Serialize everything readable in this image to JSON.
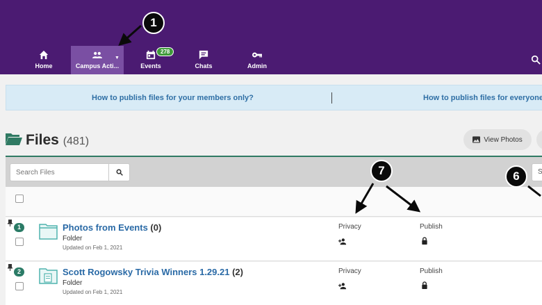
{
  "nav": {
    "items": [
      {
        "label": "Home",
        "icon": "home-icon"
      },
      {
        "label": "Campus Acti...",
        "icon": "people-icon",
        "active": true
      },
      {
        "label": "Events",
        "icon": "calendar-icon",
        "badge": "278"
      },
      {
        "label": "Chats",
        "icon": "chat-icon"
      },
      {
        "label": "Admin",
        "icon": "key-icon"
      }
    ]
  },
  "banner": {
    "link_left": "How to publish files for your members only?",
    "link_right": "How to publish files for everyone t"
  },
  "files": {
    "title": "Files",
    "count": "(481)",
    "view_photos_label": "View Photos"
  },
  "toolbar": {
    "search_placeholder": "Search Files",
    "sort_label": "S"
  },
  "rows": [
    {
      "badge": "1",
      "name": "Photos from Events",
      "count": "(0)",
      "type": "Folder",
      "updated": "Updated on Feb 1, 2021",
      "privacy_label": "Privacy",
      "publish_label": "Publish"
    },
    {
      "badge": "2",
      "name": "Scott Rogowsky Trivia Winners 1.29.21",
      "count": "(2)",
      "type": "Folder",
      "updated": "Updated on Feb 1, 2021",
      "privacy_label": "Privacy",
      "publish_label": "Publish"
    }
  ],
  "annotations": {
    "step_1": "1",
    "step_7": "7",
    "step_6": "6"
  },
  "colors": {
    "nav_bg": "#4b1b72",
    "nav_active": "#7a4fa3",
    "accent_green": "#2f7a63",
    "link_blue": "#2a6aa6",
    "banner_bg": "#d8ebf6"
  }
}
